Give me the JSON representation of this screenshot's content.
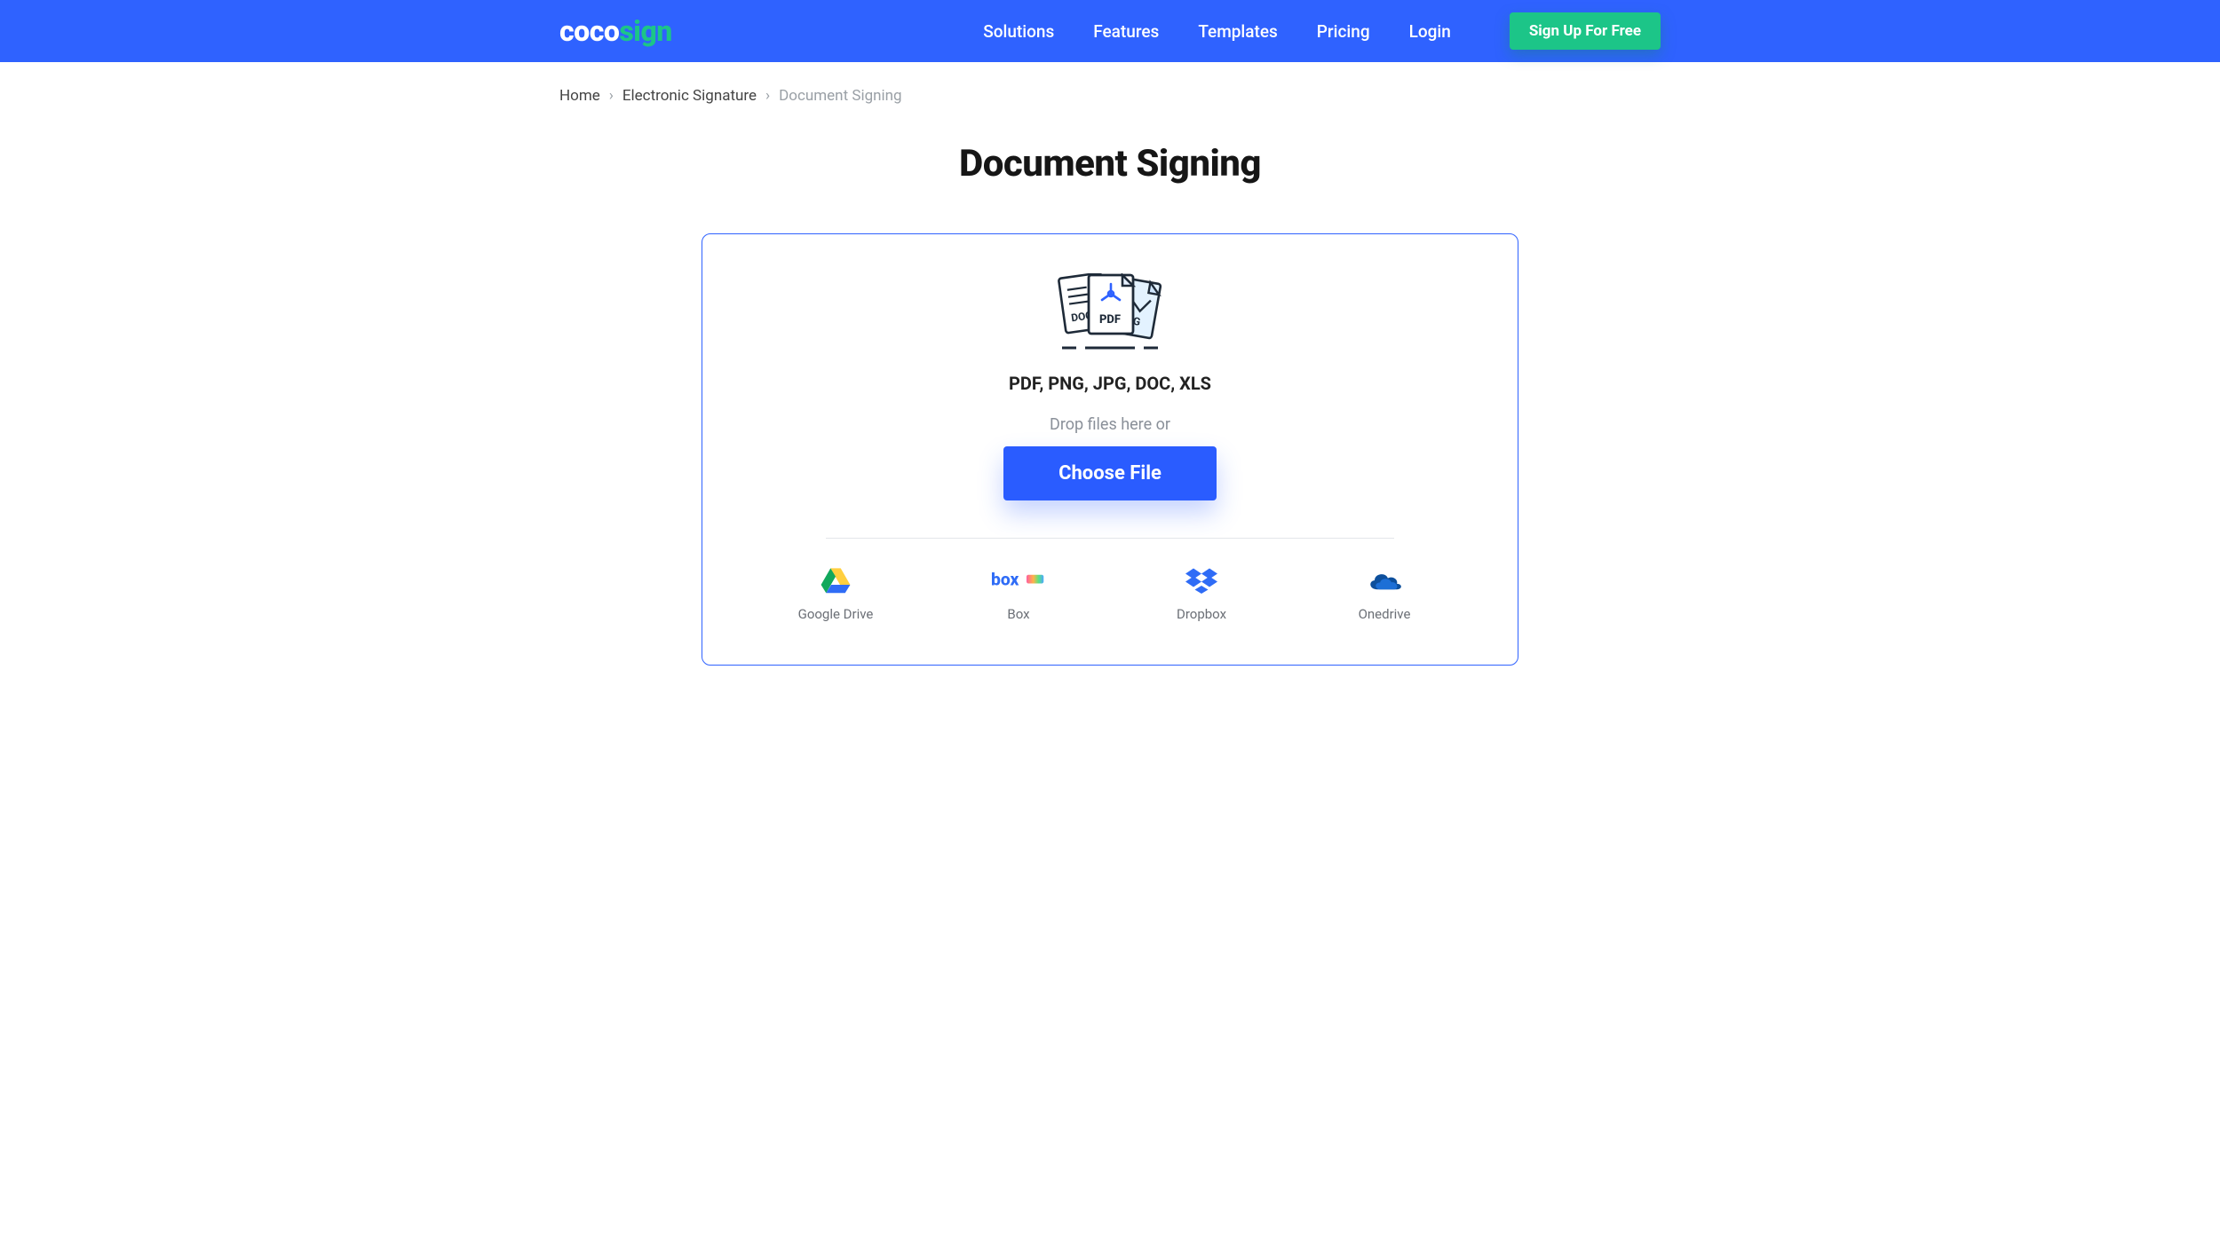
{
  "brand": {
    "p1": "coco",
    "p2": "sign"
  },
  "nav": {
    "solutions": "Solutions",
    "features": "Features",
    "templates": "Templates",
    "pricing": "Pricing",
    "login": "Login",
    "signup": "Sign Up For Free"
  },
  "breadcrumb": {
    "home": "Home",
    "l2": "Electronic Signature",
    "current": "Document Signing"
  },
  "page": {
    "title": "Document Signing"
  },
  "upload": {
    "formats": "PDF, PNG, JPG, DOC, XLS",
    "drop_hint": "Drop files here or",
    "choose": "Choose File"
  },
  "providers": {
    "gdrive": "Google Drive",
    "box": "Box",
    "dropbox": "Dropbox",
    "onedrive": "Onedrive"
  },
  "colors": {
    "blue": "#2f62ff",
    "green": "#1cc588"
  }
}
